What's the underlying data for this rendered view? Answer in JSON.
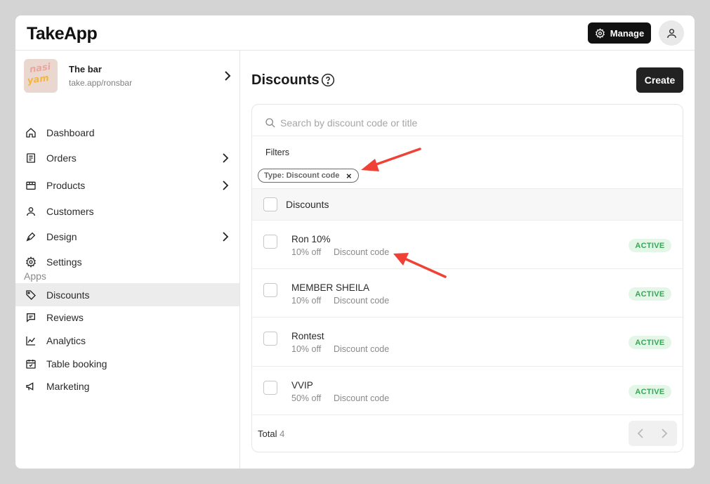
{
  "app": {
    "name": "TakeApp"
  },
  "header": {
    "manage_label": "Manage"
  },
  "store": {
    "name": "The bar",
    "url": "take.app/ronsbar",
    "logo_text_1": "nasi",
    "logo_text_2": "yam"
  },
  "sidebar": {
    "items": [
      {
        "label": "Dashboard"
      },
      {
        "label": "Orders"
      },
      {
        "label": "Products"
      },
      {
        "label": "Customers"
      },
      {
        "label": "Design"
      },
      {
        "label": "Settings"
      }
    ],
    "apps_label": "Apps",
    "apps": [
      {
        "label": "Discounts"
      },
      {
        "label": "Reviews"
      },
      {
        "label": "Analytics"
      },
      {
        "label": "Table booking"
      },
      {
        "label": "Marketing"
      }
    ]
  },
  "main": {
    "title": "Discounts",
    "create_label": "Create",
    "search_placeholder": "Search by discount code or title",
    "filters_label": "Filters",
    "filter_chip": "Type: Discount code",
    "filter_chip_close": "×",
    "table_header": "Discounts",
    "rows": [
      {
        "title": "Ron 10%",
        "pct": "10% off",
        "type": "Discount code",
        "status": "ACTIVE"
      },
      {
        "title": "MEMBER SHEILA",
        "pct": "10% off",
        "type": "Discount code",
        "status": "ACTIVE"
      },
      {
        "title": "Rontest",
        "pct": "10% off",
        "type": "Discount code",
        "status": "ACTIVE"
      },
      {
        "title": "VVIP",
        "pct": "50% off",
        "type": "Discount code",
        "status": "ACTIVE"
      }
    ],
    "total_label": "Total",
    "total_count": "4"
  },
  "colors": {
    "active_green": "#34a853",
    "annotation_red": "#ef4136",
    "dark_button": "#111111"
  }
}
